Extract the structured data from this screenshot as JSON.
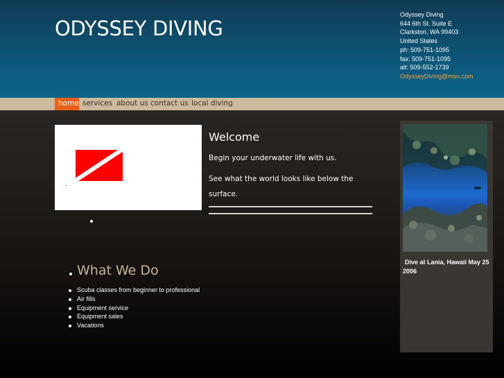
{
  "header": {
    "site_title": "ODYSSEY DIVING",
    "contact": {
      "name": "Odyssey Diving",
      "address1": "644 6th St. Suite E",
      "address2": "Clarkston, WA 99403",
      "country": "United States",
      "phone": "ph: 509-751-1095",
      "fax": "fax: 509-751-1095",
      "alt": "alt: 509-552-1739",
      "email": "OdysseyDiving@msn.com"
    }
  },
  "nav": {
    "items": [
      {
        "label": "home",
        "active": true
      },
      {
        "label": "services",
        "active": false
      },
      {
        "label": "about us",
        "active": false
      },
      {
        "label": "contact us",
        "active": false
      },
      {
        "label": "local diving",
        "active": false
      }
    ]
  },
  "welcome": {
    "title": "Welcome",
    "line1": "Begin your underwater life with us.",
    "line2a": "See what the world looks like below the",
    "line2b": "surface."
  },
  "what_we_do": {
    "title": "What We Do",
    "services": [
      "Scuba classes from beginner to professional",
      "Air fills",
      "Equipment service",
      "Equipment sales",
      "Vacations"
    ]
  },
  "sidebar": {
    "photo_caption": "Dive at Lania, Hawaii May 25 2006"
  },
  "colors": {
    "header_blue": "#0d5a7e",
    "nav_tan": "#cdb99d",
    "nav_active": "#e8611a",
    "heading_tan": "#c7b59c",
    "email_orange": "#f2a23a",
    "dive_flag_red": "#ff0000"
  }
}
